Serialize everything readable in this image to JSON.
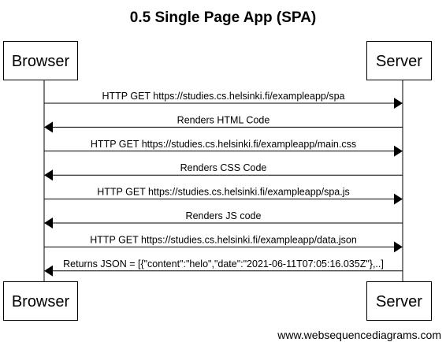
{
  "title": "0.5 Single Page App (SPA)",
  "participants": [
    "Browser",
    "Server"
  ],
  "messages": [
    {
      "from": "Browser",
      "to": "Server",
      "label": "HTTP GET https://studies.cs.helsinki.fi/exampleapp/spa"
    },
    {
      "from": "Server",
      "to": "Browser",
      "label": "Renders HTML Code"
    },
    {
      "from": "Browser",
      "to": "Server",
      "label": "HTTP GET https://studies.cs.helsinki.fi/exampleapp/main.css"
    },
    {
      "from": "Server",
      "to": "Browser",
      "label": "Renders CSS Code"
    },
    {
      "from": "Browser",
      "to": "Server",
      "label": "HTTP GET https://studies.cs.helsinki.fi/exampleapp/spa.js"
    },
    {
      "from": "Server",
      "to": "Browser",
      "label": "Renders JS code"
    },
    {
      "from": "Browser",
      "to": "Server",
      "label": "HTTP GET https://studies.cs.helsinki.fi/exampleapp/data.json"
    },
    {
      "from": "Server",
      "to": "Browser",
      "label": "Returns JSON = [{\"content\":\"helo\",\"date\":\"2021-06-11T07:05:16.035Z\"},..]"
    }
  ],
  "watermark": "www.websequencediagrams.com"
}
